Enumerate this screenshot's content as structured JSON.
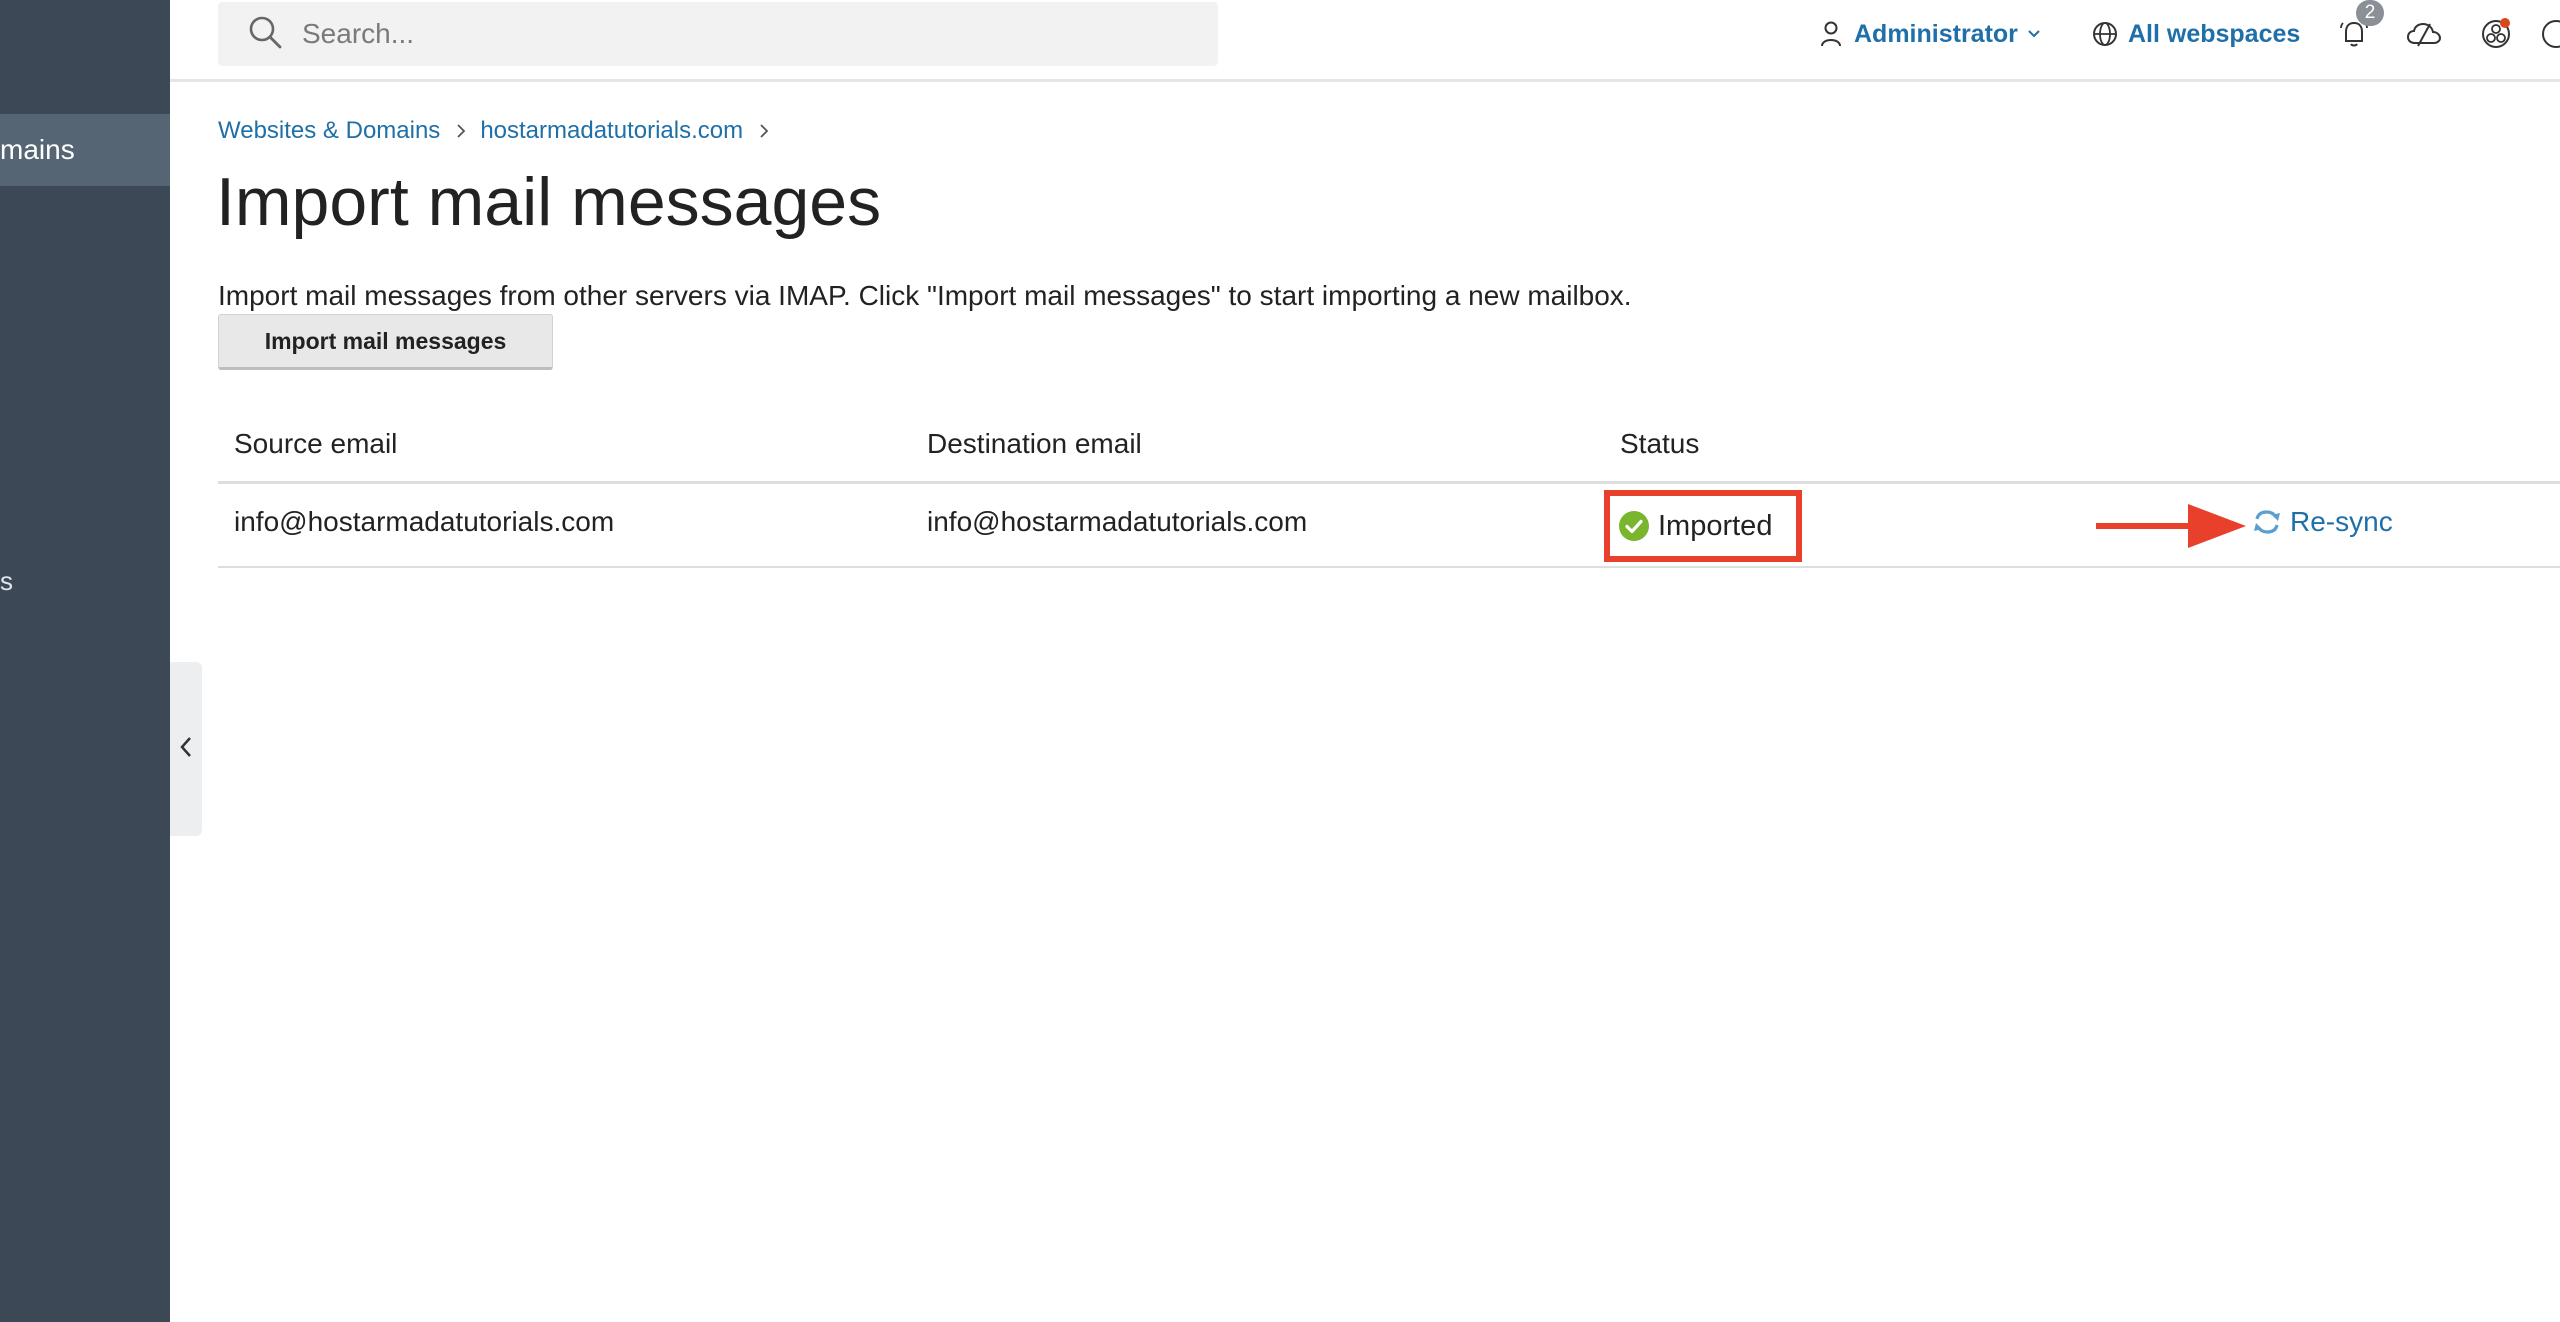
{
  "sidebar": {
    "active_item_label": "mains",
    "partial_item_label": "s"
  },
  "header": {
    "search": {
      "placeholder": "Search...",
      "value": ""
    },
    "user_menu_label": "Administrator",
    "webspaces_label": "All webspaces",
    "notifications_count": "2"
  },
  "breadcrumb": {
    "items": [
      {
        "label": "Websites & Domains"
      },
      {
        "label": "hostarmadatutorials.com"
      }
    ]
  },
  "page": {
    "title": "Import mail messages",
    "description": "Import mail messages from other servers via IMAP. Click \"Import mail messages\" to start importing a new mailbox.",
    "import_button_label": "Import mail messages"
  },
  "table": {
    "headers": {
      "source": "Source email",
      "destination": "Destination email",
      "status": "Status"
    },
    "rows": [
      {
        "source": "info@hostarmadatutorials.com",
        "destination": "info@hostarmadatutorials.com",
        "status": "Imported",
        "action": "Re-sync"
      }
    ]
  },
  "colors": {
    "sidebar_bg": "#3c4856",
    "link": "#1f6fa8",
    "annotation": "#e8402a",
    "success": "#7ab52e"
  },
  "icons": {
    "search": "search-icon",
    "user": "user-icon",
    "globe": "globe-icon",
    "notifications": "bell-icon",
    "cloud": "cloud-icon",
    "extensions": "extensions-icon",
    "status": "check-circle-icon",
    "resync": "sync-icon"
  }
}
